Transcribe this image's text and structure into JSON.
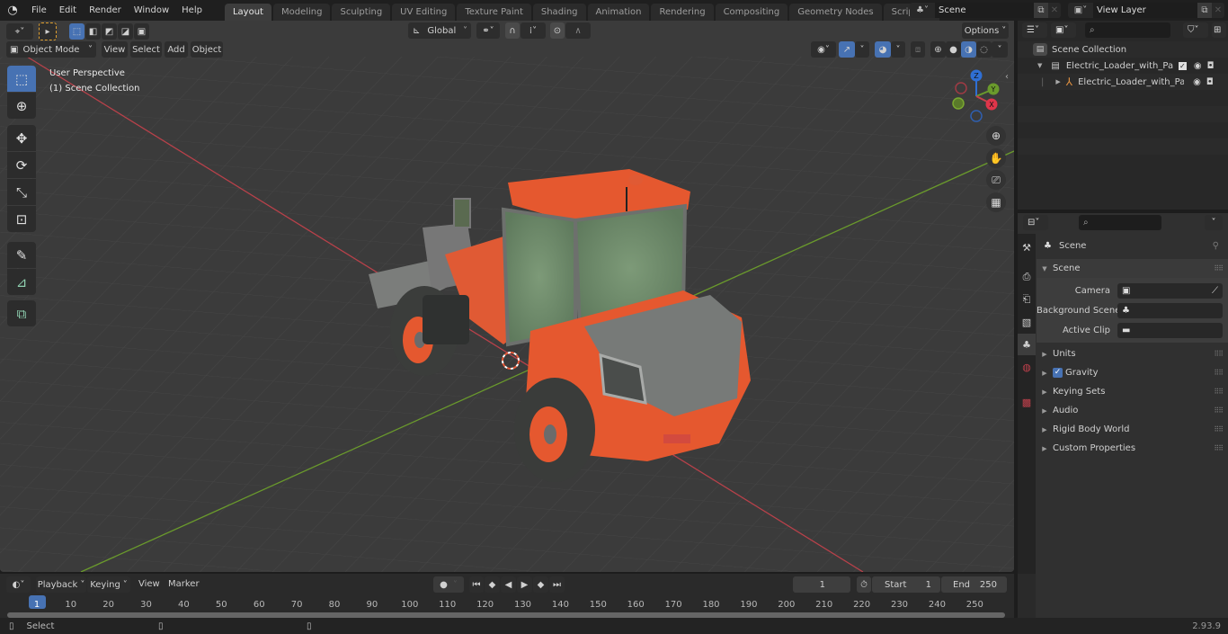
{
  "topbar": {
    "menus": [
      "File",
      "Edit",
      "Render",
      "Window",
      "Help"
    ],
    "workspaces": [
      "Layout",
      "Modeling",
      "Sculpting",
      "UV Editing",
      "Texture Paint",
      "Shading",
      "Animation",
      "Rendering",
      "Compositing",
      "Geometry Nodes",
      "Scripting"
    ],
    "active_workspace": "Layout",
    "add_workspace": "+",
    "scene_name": "Scene",
    "view_layer": "View Layer"
  },
  "viewport": {
    "mode": "Object Mode",
    "menus": [
      "View",
      "Select",
      "Add",
      "Object"
    ],
    "transform_orientation": "Global",
    "options_label": "Options",
    "overlay_title": "User Perspective",
    "overlay_collection": "(1) Scene Collection",
    "gizmo_axes": [
      "Z",
      "Y",
      "X"
    ],
    "tools": [
      "select-box",
      "cursor",
      "move",
      "rotate",
      "scale",
      "transform",
      "annotate",
      "measure",
      "add-cube"
    ],
    "colors": {
      "x_axis": "#c8414b",
      "y_axis": "#6a9a2c",
      "z_axis": "#2f6fd4",
      "loader_orange": "#e5582f",
      "accent": "#4772b3"
    }
  },
  "outliner": {
    "root": "Scene Collection",
    "items": [
      {
        "name": "Electric_Loader_with_Pallet_F",
        "type": "collection",
        "checked": true
      },
      {
        "name": "Electric_Loader_with_Pall",
        "type": "armature"
      }
    ]
  },
  "properties": {
    "context": "Scene",
    "panel_title": "Scene",
    "fields": [
      {
        "label": "Camera",
        "value": ""
      },
      {
        "label": "Background Scene",
        "value": ""
      },
      {
        "label": "Active Clip",
        "value": ""
      }
    ],
    "sections": [
      {
        "label": "Units"
      },
      {
        "label": "Gravity",
        "checkbox": true
      },
      {
        "label": "Keying Sets"
      },
      {
        "label": "Audio"
      },
      {
        "label": "Rigid Body World"
      },
      {
        "label": "Custom Properties"
      }
    ]
  },
  "timeline": {
    "menus": [
      "Playback",
      "Keying",
      "View",
      "Marker"
    ],
    "current_frame": "1",
    "start_label": "Start",
    "start": "1",
    "end_label": "End",
    "end": "250",
    "ticks": [
      "1",
      "10",
      "20",
      "30",
      "40",
      "50",
      "60",
      "70",
      "80",
      "90",
      "100",
      "110",
      "120",
      "130",
      "140",
      "150",
      "160",
      "170",
      "180",
      "190",
      "200",
      "210",
      "220",
      "230",
      "240",
      "250"
    ]
  },
  "statusbar": {
    "select_label": "Select",
    "version": "2.93.9"
  }
}
